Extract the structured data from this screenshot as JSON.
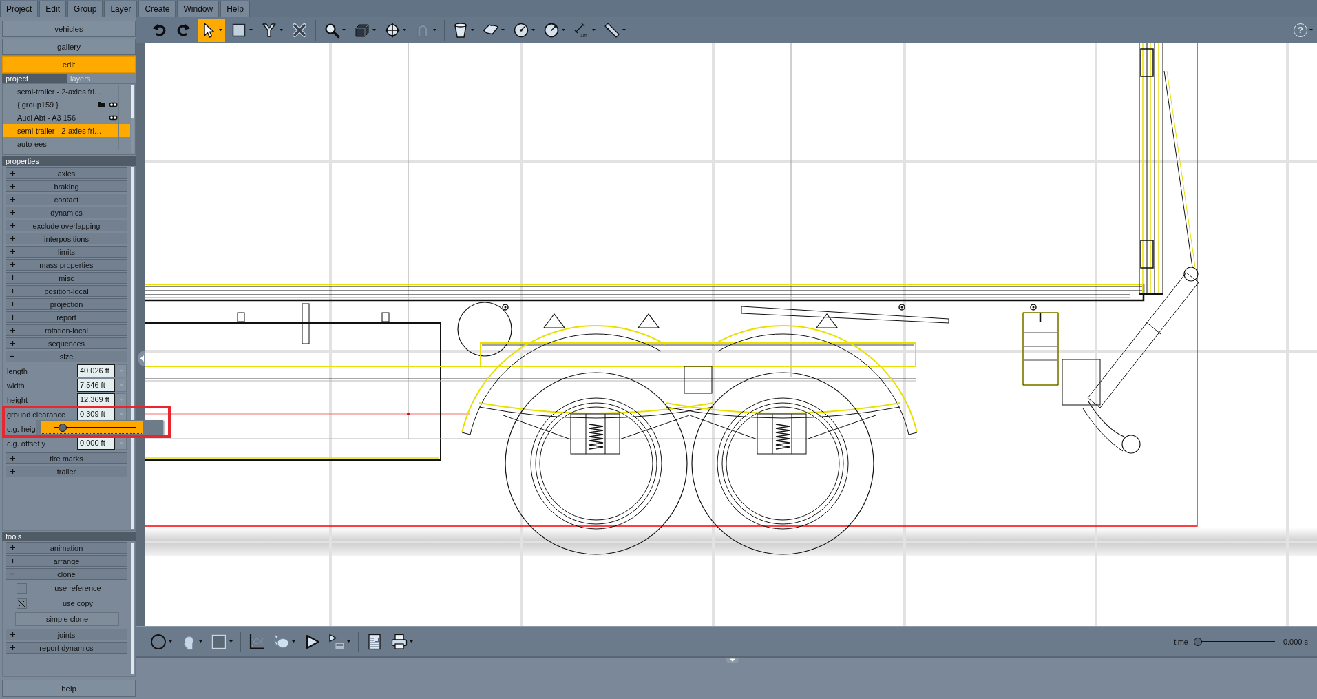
{
  "menu_bar": {
    "items": [
      "Project",
      "Edit",
      "Group",
      "Layer",
      "Create",
      "Window",
      "Help"
    ]
  },
  "toolbar": {
    "groups": [
      [
        {
          "kind": "undo",
          "dropdown": false,
          "selected": false,
          "disabled": false
        },
        {
          "kind": "redo",
          "dropdown": false,
          "selected": false,
          "disabled": false
        },
        {
          "kind": "select",
          "dropdown": true,
          "selected": true,
          "disabled": false
        },
        {
          "kind": "rectangle",
          "dropdown": true,
          "selected": false,
          "disabled": false
        },
        {
          "kind": "fork",
          "dropdown": true,
          "selected": false,
          "disabled": false
        },
        {
          "kind": "delete",
          "dropdown": false,
          "selected": false,
          "disabled": false
        }
      ],
      [
        {
          "kind": "zoom",
          "dropdown": true,
          "selected": false,
          "disabled": false
        },
        {
          "kind": "cube",
          "dropdown": true,
          "selected": false,
          "disabled": false
        },
        {
          "kind": "move",
          "dropdown": true,
          "selected": false,
          "disabled": false
        },
        {
          "kind": "magnet",
          "dropdown": true,
          "selected": false,
          "disabled": true
        }
      ],
      [
        {
          "kind": "cup",
          "dropdown": true,
          "selected": false,
          "disabled": false
        },
        {
          "kind": "sheet",
          "dropdown": true,
          "selected": false,
          "disabled": false
        },
        {
          "kind": "dial",
          "dropdown": true,
          "selected": false,
          "disabled": false
        },
        {
          "kind": "dial_edge",
          "dropdown": true,
          "selected": false,
          "disabled": false
        },
        {
          "kind": "measure",
          "dropdown": true,
          "selected": false,
          "disabled": false,
          "label": "1m"
        },
        {
          "kind": "pipe",
          "dropdown": true,
          "selected": false,
          "disabled": false
        }
      ]
    ],
    "help": {
      "label": "?",
      "dropdown": true
    }
  },
  "nav_buttons": [
    {
      "label": "vehicles",
      "selected": false
    },
    {
      "label": "gallery",
      "selected": false
    },
    {
      "label": "edit",
      "selected": true
    }
  ],
  "tree_tabs": [
    {
      "label": "project",
      "selected": true
    },
    {
      "label": "layers",
      "selected": false
    }
  ],
  "project_items": [
    {
      "label": "semi-trailer - 2-axles fri…",
      "selected": false,
      "is_group": false,
      "visible": false
    },
    {
      "label": "{ group159 }",
      "selected": false,
      "is_group": true,
      "visible": true
    },
    {
      "label": "Audi Abt - A3 156",
      "selected": false,
      "is_group": false,
      "visible": true
    },
    {
      "label": "semi-trailer - 2-axles fri…",
      "selected": true,
      "is_group": false,
      "visible": false
    },
    {
      "label": "auto-ees",
      "selected": false,
      "is_group": false,
      "visible": false
    }
  ],
  "properties": {
    "title": "properties",
    "sections": [
      {
        "label": "axles",
        "expanded": false
      },
      {
        "label": "braking",
        "expanded": false
      },
      {
        "label": "contact",
        "expanded": false
      },
      {
        "label": "dynamics",
        "expanded": false
      },
      {
        "label": "exclude overlapping",
        "expanded": false
      },
      {
        "label": "interpositions",
        "expanded": false
      },
      {
        "label": "limits",
        "expanded": false
      },
      {
        "label": "mass properties",
        "expanded": false
      },
      {
        "label": "misc",
        "expanded": false
      },
      {
        "label": "position-local",
        "expanded": false
      },
      {
        "label": "projection",
        "expanded": false
      },
      {
        "label": "report",
        "expanded": false
      },
      {
        "label": "rotation-local",
        "expanded": false
      },
      {
        "label": "sequences",
        "expanded": false
      },
      {
        "label": "size",
        "expanded": true,
        "fields": [
          {
            "kind": "number",
            "label": "length",
            "value": "40.026 ft"
          },
          {
            "kind": "number",
            "label": "width",
            "value": "7.546 ft"
          },
          {
            "kind": "number",
            "label": "height",
            "value": "12.369 ft"
          },
          {
            "kind": "number",
            "label": "ground clearance",
            "value": "0.309 ft"
          },
          {
            "kind": "slider",
            "label": "c.g. heig",
            "level": 0.1
          },
          {
            "kind": "number",
            "label": "c.g. offset y",
            "value": "0.000 ft"
          }
        ]
      },
      {
        "label": "tire marks",
        "expanded": false
      },
      {
        "label": "trailer",
        "expanded": false
      }
    ]
  },
  "tools": {
    "title": "tools",
    "sections": [
      {
        "label": "animation",
        "expanded": false
      },
      {
        "label": "arrange",
        "expanded": false
      },
      {
        "label": "clone",
        "expanded": true,
        "items": [
          {
            "kind": "checkbox",
            "label": "use reference",
            "checked": false
          },
          {
            "kind": "checkbox",
            "label": "use copy",
            "checked": true
          },
          {
            "kind": "button",
            "label": "simple clone"
          }
        ]
      },
      {
        "label": "joints",
        "expanded": false
      },
      {
        "label": "report dynamics",
        "expanded": false
      }
    ]
  },
  "help_button": "help",
  "bottom_toolbar": {
    "groups": [
      [
        {
          "kind": "circle",
          "dropdown": true
        },
        {
          "kind": "head",
          "dropdown": true
        },
        {
          "kind": "square",
          "dropdown": true
        }
      ],
      [
        {
          "kind": "chart",
          "dropdown": false
        },
        {
          "kind": "teapot",
          "dropdown": true
        },
        {
          "kind": "play",
          "dropdown": false
        },
        {
          "kind": "play_list",
          "dropdown": true
        }
      ],
      [
        {
          "kind": "notepad",
          "dropdown": false
        },
        {
          "kind": "printer",
          "dropdown": true
        }
      ]
    ],
    "time": {
      "label": "time",
      "level": 0,
      "reading": "0.000 s"
    }
  }
}
